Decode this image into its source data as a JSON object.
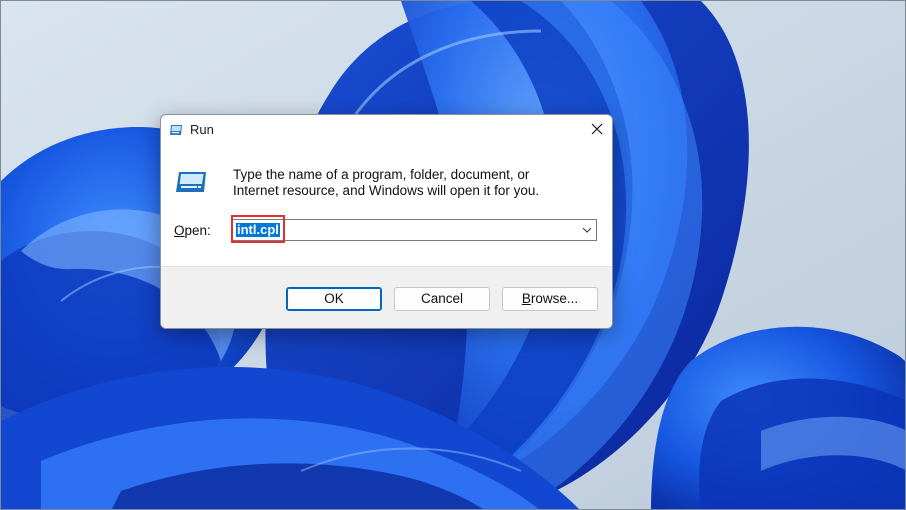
{
  "dialog": {
    "title": "Run",
    "description_line1": "Type the name of a program, folder, document, or",
    "description_line2": "Internet resource, and Windows will open it for you.",
    "open_label_accel": "O",
    "open_label_rest": "pen:",
    "open_value": "intl.cpl",
    "buttons": {
      "ok": "OK",
      "cancel": "Cancel",
      "browse_accel": "B",
      "browse_rest": "rowse..."
    }
  },
  "icons": {
    "title_icon": "run-icon",
    "large_icon": "run-icon",
    "close_icon": "close-icon",
    "dropdown_icon": "chevron-down-icon"
  },
  "colors": {
    "selection": "#0078d7",
    "annotation_highlight": "#e0302f",
    "default_button_border": "#0067c0",
    "wallpaper_base": "#cfdbe6",
    "wallpaper_bloom": "#1f5fe0"
  }
}
